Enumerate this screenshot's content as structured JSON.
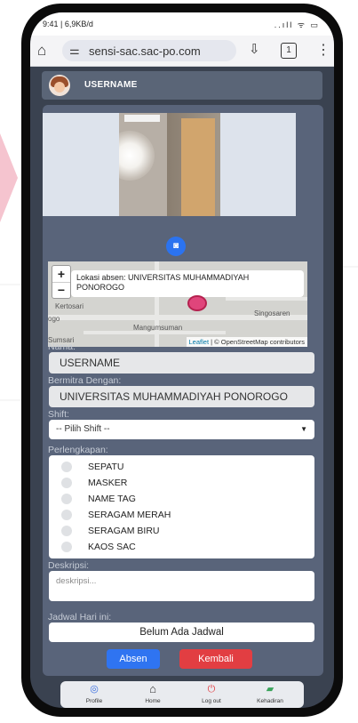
{
  "status_bar": {
    "time_speed": "9:41 | 6,9KB/d",
    "right_icons": "..ıll ᯤ ▭"
  },
  "browser": {
    "url": "sensi-sac.sac-po.com",
    "tab_count": "1"
  },
  "header": {
    "username": "USERNAME"
  },
  "map": {
    "popup_text": "Lokasi absen: UNIVERSITAS MUHAMMADIYAH PONOROGO",
    "labels": [
      "Kertosari",
      "Mangumsuman",
      "Singosaren",
      "Sumsari",
      "ogo"
    ],
    "zoom_in": "+",
    "zoom_out": "−",
    "attribution_leaflet": "Leaflet",
    "attribution_rest": " | © OpenStreetMap contributors"
  },
  "form": {
    "nama_label": "Nama:",
    "nama_value": "USERNAME",
    "mitra_label": "Bermitra Dengan:",
    "mitra_value": "UNIVERSITAS MUHAMMADIYAH PONOROGO",
    "shift_label": "Shift:",
    "shift_selected": "-- Pilih Shift --",
    "perlengkapan_label": "Perlengkapan:",
    "perlengkapan": [
      "SEPATU",
      "MASKER",
      "NAME TAG",
      "SERAGAM MERAH",
      "SERAGAM BIRU",
      "KAOS SAC"
    ],
    "deskripsi_label": "Deskripsi:",
    "deskripsi_placeholder": "deskripsi...",
    "jadwal_label": "Jadwal Hari ini:",
    "jadwal_value": "Belum Ada Jadwal",
    "absen_button": "Absen",
    "kembali_button": "Kembali"
  },
  "bottom_nav": [
    {
      "label": "Profile",
      "icon": "profile-icon",
      "color": "#3b6fe0"
    },
    {
      "label": "Home",
      "icon": "home-icon",
      "color": "#333333"
    },
    {
      "label": "Log out",
      "icon": "power-icon",
      "color": "#e23e42"
    },
    {
      "label": "Kehadiran",
      "icon": "attendance-icon",
      "color": "#3aa35a"
    }
  ],
  "colors": {
    "card": "#59647a",
    "screen_bg": "#3a4250",
    "primary": "#2f74f1",
    "danger": "#e23e42"
  }
}
